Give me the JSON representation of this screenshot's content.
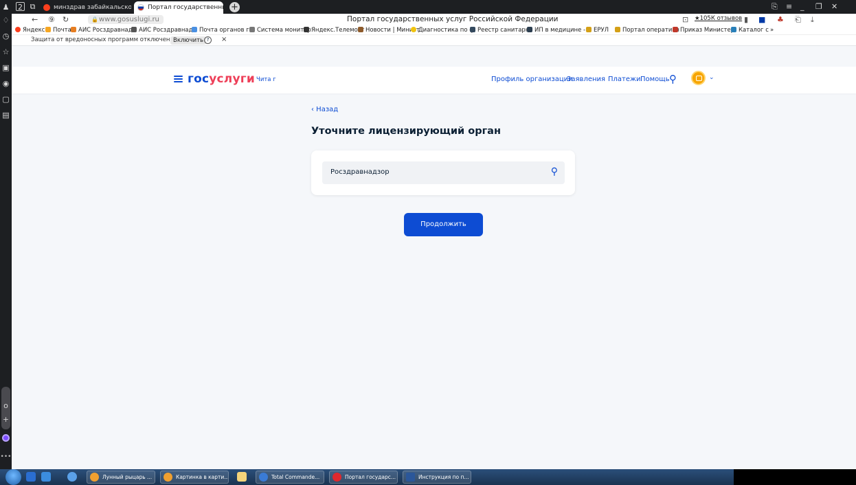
{
  "browser": {
    "tabs": [
      {
        "label": "минздрав забайкальского"
      },
      {
        "label": "Портал государственных ×"
      }
    ],
    "url": "www.gosuslugi.ru",
    "page_title": "Портал государственных услуг Российской Федерации",
    "reviews": "★105К отзывов",
    "bookmarks": [
      "Яндекс",
      "Почта",
      "АИС Росздравнад",
      "АИС Росздравнад",
      "Почта органов го",
      "Система монитор",
      "Яндекс.Телемост",
      "Новости | Минист",
      "Диагностика по ф",
      "Реестр санитарно",
      "ИП в медицине -",
      "ЕРУЛ",
      "Портал оперативн",
      "Приказ Министер",
      "Каталог с",
      "»"
    ],
    "protection": {
      "text": "Защита от вредоносных программ отключена",
      "button": "Включить",
      "help": "?",
      "close": "×"
    }
  },
  "site": {
    "logo_part1": "гос",
    "logo_part2": "услуги",
    "city": "Чита г",
    "nav": [
      "Профиль организации",
      "Заявления",
      "Платежи",
      "Помощь"
    ]
  },
  "main": {
    "back": "‹ Назад",
    "title": "Уточните лицензирующий орган",
    "search_value": "Росздравнадзор",
    "continue": "Продолжить"
  },
  "taskbar": {
    "items": [
      "Лунный рыцарь ...",
      "Картинка в карти...",
      "Total Commande...",
      "Портал государс...",
      "Инструкция по п..."
    ]
  },
  "colors": {
    "accent": "#0d4cd3",
    "logo_red": "#ee3f58",
    "page_bg": "#f5f7fa"
  }
}
